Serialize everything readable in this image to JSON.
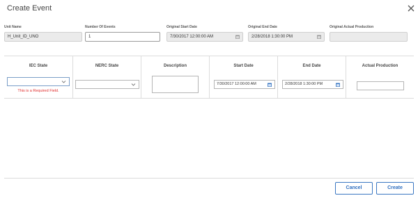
{
  "dialog": {
    "title": "Create Event"
  },
  "fields": {
    "unit_name": {
      "label": "Unit Name",
      "value": "H_Unit_ID_UNO"
    },
    "number_of_events": {
      "label": "Number Of Events",
      "value": "1"
    },
    "original_start_date": {
      "label": "Original Start Date",
      "value": "7/30/2017 12:00:00 AM"
    },
    "original_end_date": {
      "label": "Original End Date",
      "value": "2/28/2018 1:30:00 PM"
    },
    "original_actual_production": {
      "label": "Original Actual Production",
      "value": ""
    }
  },
  "grid": {
    "columns": [
      "IEC State",
      "NERC State",
      "Description",
      "Start Date",
      "End Date",
      "Actual Production"
    ],
    "row": {
      "iec_state": "",
      "iec_state_error": "This is a Required Field.",
      "nerc_state": "",
      "description": "",
      "start_date": "7/30/2017 12:00:00 AM",
      "end_date": "2/28/2018 1:30:00 PM",
      "actual_production": ""
    }
  },
  "buttons": {
    "cancel": "Cancel",
    "create": "Create"
  },
  "icons": {
    "close": "close-icon",
    "calendar": "calendar-icon",
    "dropdown": "chevron-down-icon"
  },
  "colors": {
    "accent": "#3a77c2",
    "error": "#e03030"
  }
}
